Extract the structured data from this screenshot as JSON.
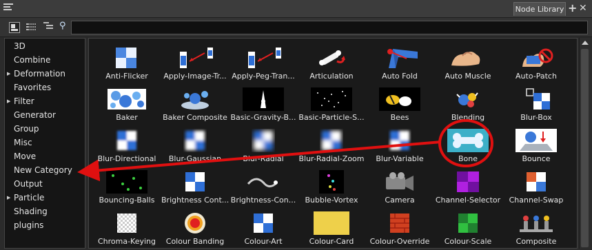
{
  "app": {
    "tab_label": "Node Library",
    "add_tab_icon": "+",
    "close_tab_icon": "✕"
  },
  "toolbar": {
    "search_value": "",
    "icons": [
      "thumbnail-view-icon",
      "list-view-icon",
      "tree-view-icon",
      "search-icon"
    ]
  },
  "sidebar": {
    "categories": [
      {
        "label": "3D",
        "expandable": false
      },
      {
        "label": "Combine",
        "expandable": false
      },
      {
        "label": "Deformation",
        "expandable": true
      },
      {
        "label": "Favorites",
        "expandable": false
      },
      {
        "label": "Filter",
        "expandable": true
      },
      {
        "label": "Generator",
        "expandable": false
      },
      {
        "label": "Group",
        "expandable": false
      },
      {
        "label": "Misc",
        "expandable": false
      },
      {
        "label": "Move",
        "expandable": false
      },
      {
        "label": "New Category",
        "expandable": false
      },
      {
        "label": "Output",
        "expandable": false
      },
      {
        "label": "Particle",
        "expandable": true
      },
      {
        "label": "Shading",
        "expandable": false
      },
      {
        "label": "plugins",
        "expandable": false
      }
    ]
  },
  "nodes": [
    {
      "label": "Anti-Flicker",
      "icon": "anti-flicker-icon"
    },
    {
      "label": "Apply-Image-Tr...",
      "icon": "apply-image-transformation-icon"
    },
    {
      "label": "Apply-Peg-Tran...",
      "icon": "apply-peg-transformation-icon"
    },
    {
      "label": "Articulation",
      "icon": "articulation-icon"
    },
    {
      "label": "Auto Fold",
      "icon": "auto-fold-icon"
    },
    {
      "label": "Auto Muscle",
      "icon": "auto-muscle-icon"
    },
    {
      "label": "Auto-Patch",
      "icon": "auto-patch-icon"
    },
    {
      "label": "Baker",
      "icon": "baker-icon"
    },
    {
      "label": "Baker Composite",
      "icon": "baker-composite-icon"
    },
    {
      "label": "Basic-Gravity-B...",
      "icon": "basic-gravity-icon"
    },
    {
      "label": "Basic-Particle-S...",
      "icon": "basic-particle-icon"
    },
    {
      "label": "Bees",
      "icon": "bees-icon"
    },
    {
      "label": "Blending",
      "icon": "blending-icon"
    },
    {
      "label": "Blur-Box",
      "icon": "blur-box-icon"
    },
    {
      "label": "Blur-Directional",
      "icon": "blur-directional-icon"
    },
    {
      "label": "Blur-Gaussian",
      "icon": "blur-gaussian-icon"
    },
    {
      "label": "Blur-Radial",
      "icon": "blur-radial-icon"
    },
    {
      "label": "Blur-Radial-Zoom",
      "icon": "blur-radial-zoom-icon"
    },
    {
      "label": "Blur-Variable",
      "icon": "blur-variable-icon"
    },
    {
      "label": "Bone",
      "icon": "bone-icon"
    },
    {
      "label": "Bounce",
      "icon": "bounce-icon"
    },
    {
      "label": "Bouncing-Balls",
      "icon": "bouncing-balls-icon"
    },
    {
      "label": "Brightness Cont...",
      "icon": "brightness-contrast-icon"
    },
    {
      "label": "Brightness-Con...",
      "icon": "brightness-control-icon"
    },
    {
      "label": "Bubble-Vortex",
      "icon": "bubble-vortex-icon"
    },
    {
      "label": "Camera",
      "icon": "camera-icon"
    },
    {
      "label": "Channel-Selector",
      "icon": "channel-selector-icon"
    },
    {
      "label": "Channel-Swap",
      "icon": "channel-swap-icon"
    },
    {
      "label": "Chroma-Keying",
      "icon": "chroma-keying-icon"
    },
    {
      "label": "Colour Banding",
      "icon": "colour-banding-icon"
    },
    {
      "label": "Colour-Art",
      "icon": "colour-art-icon"
    },
    {
      "label": "Colour-Card",
      "icon": "colour-card-icon"
    },
    {
      "label": "Colour-Override",
      "icon": "colour-override-icon"
    },
    {
      "label": "Colour-Scale",
      "icon": "colour-scale-icon"
    },
    {
      "label": "Composite",
      "icon": "composite-icon"
    }
  ],
  "annotation": {
    "color": "#e01010",
    "highlighted_node": "Bone",
    "arrow_target_category": "New Category"
  }
}
